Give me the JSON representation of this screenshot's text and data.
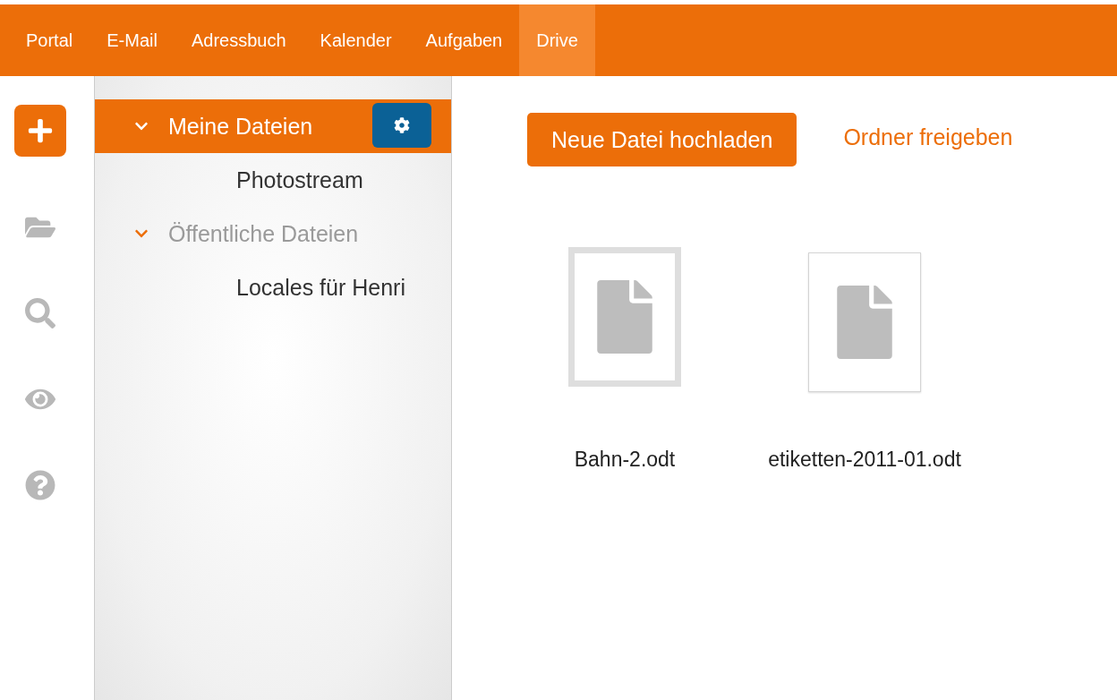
{
  "nav": {
    "tabs": [
      {
        "label": "Portal",
        "selected": false
      },
      {
        "label": "E-Mail",
        "selected": false
      },
      {
        "label": "Adressbuch",
        "selected": false
      },
      {
        "label": "Kalender",
        "selected": false
      },
      {
        "label": "Aufgaben",
        "selected": false
      },
      {
        "label": "Drive",
        "selected": true
      }
    ]
  },
  "tree": {
    "items": [
      {
        "label": "Meine Dateien",
        "selected": true,
        "expanded": true,
        "children": [
          {
            "label": "Photostream",
            "selected": false
          }
        ]
      },
      {
        "label": "Öffentliche Dateien",
        "selected": false,
        "expanded": true,
        "children": [
          {
            "label": "Locales für Henri",
            "selected": false
          }
        ]
      }
    ]
  },
  "toolbar": {
    "upload_button": "Neue Datei hochladen",
    "share_link": "Ordner freigeben"
  },
  "files": [
    {
      "name": "Bahn-2.odt",
      "selected": true
    },
    {
      "name": "etiketten-2011-01.odt",
      "selected": false
    }
  ]
}
